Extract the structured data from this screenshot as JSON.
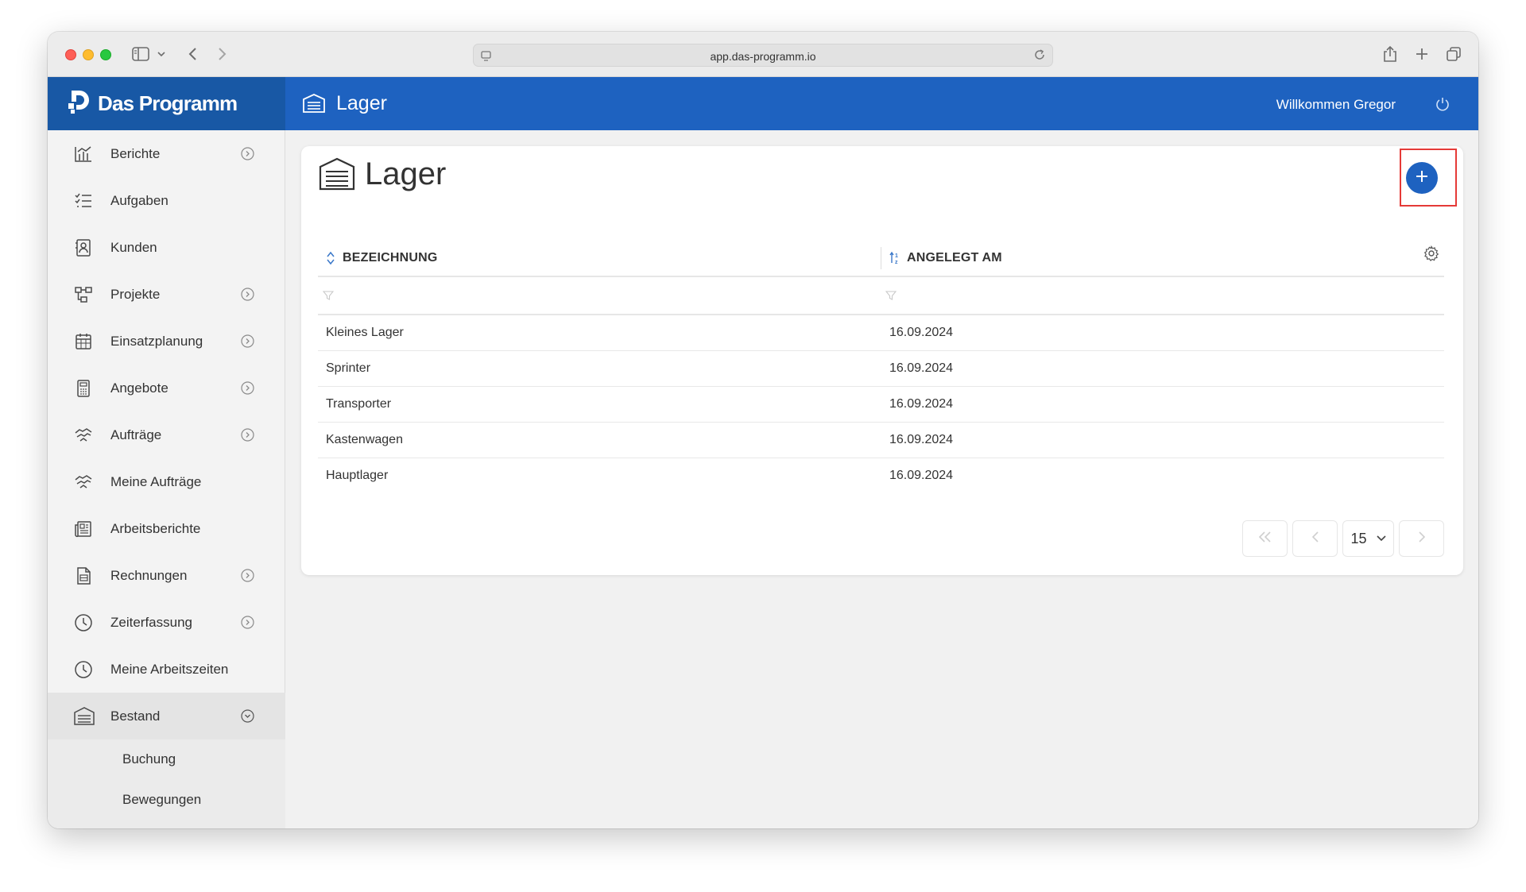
{
  "browser": {
    "url": "app.das-programm.io"
  },
  "brand": {
    "name": "Das Programm"
  },
  "header": {
    "title": "Lager",
    "welcome": "Willkommen Gregor"
  },
  "sidebar": {
    "items": [
      {
        "label": "Berichte",
        "icon": "chart-icon",
        "expandable": true
      },
      {
        "label": "Aufgaben",
        "icon": "task-list-icon",
        "expandable": false
      },
      {
        "label": "Kunden",
        "icon": "contact-card-icon",
        "expandable": false
      },
      {
        "label": "Projekte",
        "icon": "project-tree-icon",
        "expandable": true
      },
      {
        "label": "Einsatzplanung",
        "icon": "calendar-icon",
        "expandable": true
      },
      {
        "label": "Angebote",
        "icon": "calculator-icon",
        "expandable": true
      },
      {
        "label": "Aufträge",
        "icon": "handshake-icon",
        "expandable": true
      },
      {
        "label": "Meine Aufträge",
        "icon": "handshake-icon",
        "expandable": false
      },
      {
        "label": "Arbeitsberichte",
        "icon": "newspaper-icon",
        "expandable": false
      },
      {
        "label": "Rechnungen",
        "icon": "invoice-icon",
        "expandable": true
      },
      {
        "label": "Zeiterfassung",
        "icon": "clock-icon",
        "expandable": true
      },
      {
        "label": "Meine Arbeitszeiten",
        "icon": "clock-icon",
        "expandable": false
      },
      {
        "label": "Bestand",
        "icon": "warehouse-icon",
        "expandable": true,
        "expanded": true
      }
    ],
    "subitems": [
      {
        "label": "Buchung"
      },
      {
        "label": "Bewegungen"
      }
    ]
  },
  "page": {
    "title": "Lager",
    "columns": [
      "BEZEICHNUNG",
      "ANGELEGT AM"
    ],
    "rows": [
      [
        "Kleines Lager",
        "16.09.2024"
      ],
      [
        "Sprinter",
        "16.09.2024"
      ],
      [
        "Transporter",
        "16.09.2024"
      ],
      [
        "Kastenwagen",
        "16.09.2024"
      ],
      [
        "Hauptlager",
        "16.09.2024"
      ]
    ],
    "page_size": "15"
  },
  "colors": {
    "brand": "#1858a5",
    "header": "#1e62c0",
    "highlight": "#e53a37"
  }
}
